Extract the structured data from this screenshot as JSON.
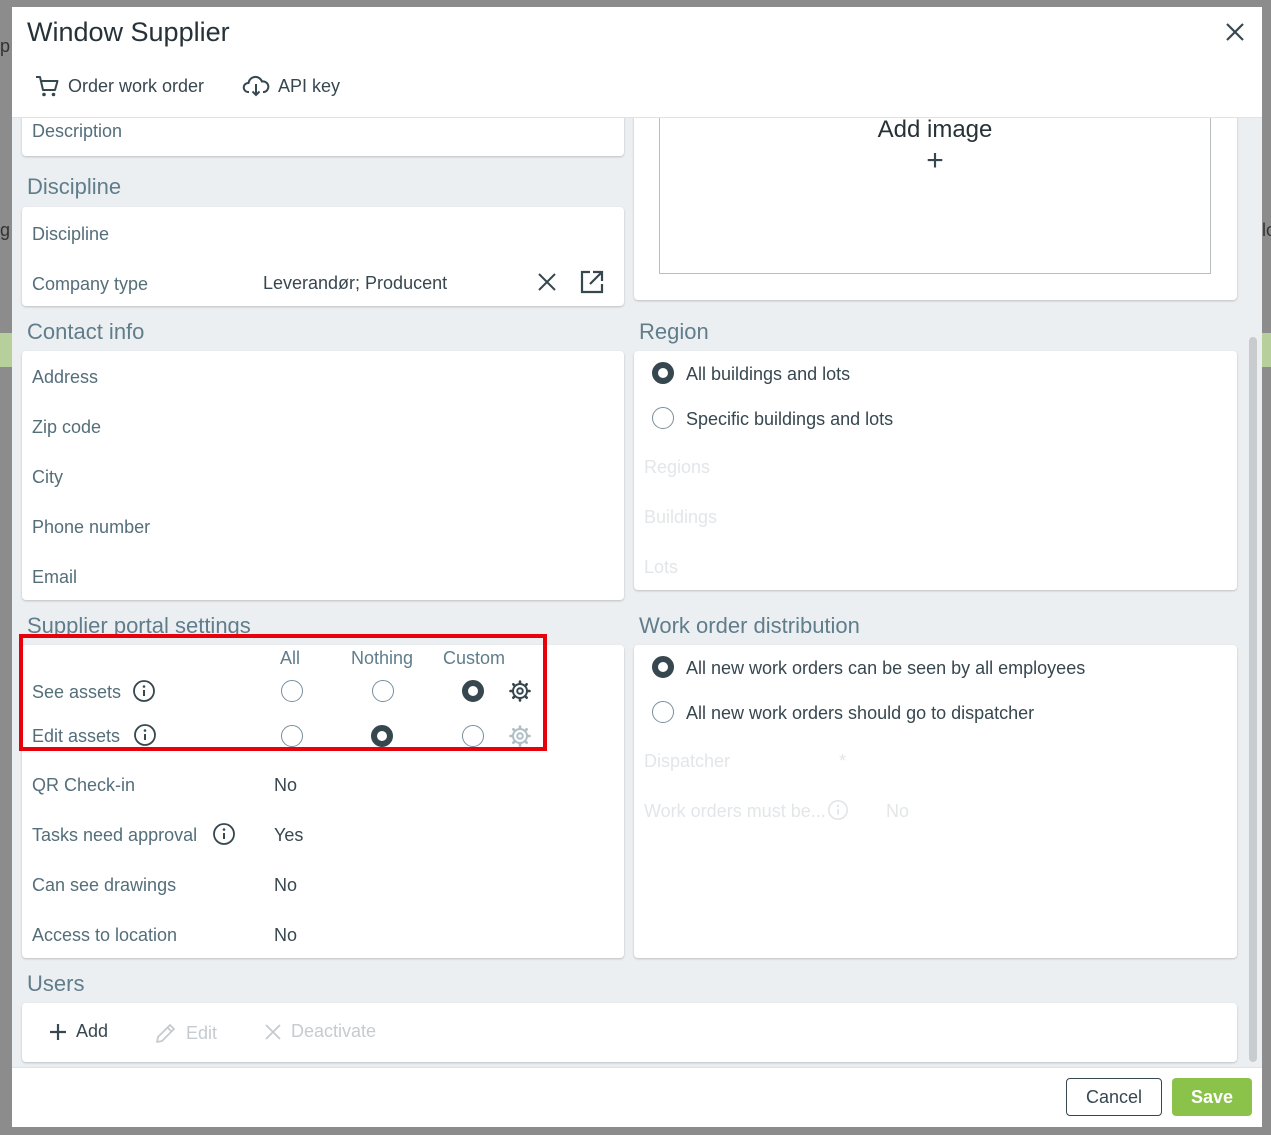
{
  "dialog": {
    "title": "Window Supplier",
    "toolbar": {
      "order_work_order": "Order work order",
      "api_key": "API key"
    }
  },
  "left": {
    "description_label": "Description",
    "discipline_section": "Discipline",
    "discipline_label": "Discipline",
    "company_type_label": "Company type",
    "company_type_value": "Leverandør; Producent",
    "contact_section": "Contact info",
    "contact_fields": [
      "Address",
      "Zip code",
      "City",
      "Phone number",
      "Email"
    ],
    "supplier_section": "Supplier portal settings",
    "assets_columns": [
      "All",
      "Nothing",
      "Custom"
    ],
    "see_assets_label": "See assets",
    "edit_assets_label": "Edit assets",
    "see_assets_selected": "Custom",
    "edit_assets_selected": "Nothing",
    "qr_checkin_label": "QR Check-in",
    "qr_checkin_value": "No",
    "tasks_approval_label": "Tasks need approval",
    "tasks_approval_value": "Yes",
    "can_see_drawings_label": "Can see drawings",
    "can_see_drawings_value": "No",
    "access_location_label": "Access to location",
    "access_location_value": "No"
  },
  "right": {
    "add_image": "Add image",
    "add_image_plus": "+",
    "region_section": "Region",
    "region_options": [
      "All buildings and lots",
      "Specific buildings and lots"
    ],
    "region_selected": "All buildings and lots",
    "region_fields": [
      "Regions",
      "Buildings",
      "Lots"
    ],
    "distribution_section": "Work order distribution",
    "distribution_options": [
      "All new work orders can be seen by all employees",
      "All new work orders should go to dispatcher"
    ],
    "distribution_selected": "All new work orders can be seen by all employees",
    "dispatcher_label": "Dispatcher",
    "dispatcher_required": "*",
    "must_be_label": "Work orders must be...",
    "must_be_value": "No"
  },
  "users": {
    "section": "Users",
    "add": "Add",
    "edit": "Edit",
    "deactivate": "Deactivate"
  },
  "footer": {
    "cancel": "Cancel",
    "save": "Save"
  },
  "background": {
    "left_fragment": "p",
    "left_fragment2": "g",
    "right_fragment": "lo"
  },
  "colors": {
    "accent": "#8bc34a",
    "highlight": "#e8000b",
    "text": "#37474f",
    "muted": "#607d8b"
  }
}
